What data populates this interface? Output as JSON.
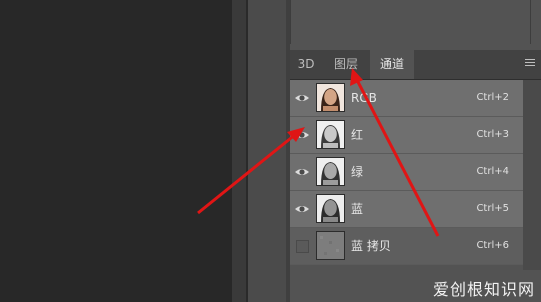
{
  "tabs": [
    {
      "label": "3D",
      "active": false
    },
    {
      "label": "图层",
      "active": false
    },
    {
      "label": "通道",
      "active": true
    }
  ],
  "panel_menu_icon": "panel-menu-icon",
  "channels": [
    {
      "name": "RGB",
      "shortcut": "Ctrl+2",
      "visible": true,
      "thumb": "color"
    },
    {
      "name": "红",
      "shortcut": "Ctrl+3",
      "visible": true,
      "thumb": "gray"
    },
    {
      "name": "绿",
      "shortcut": "Ctrl+4",
      "visible": true,
      "thumb": "gray"
    },
    {
      "name": "蓝",
      "shortcut": "Ctrl+5",
      "visible": true,
      "thumb": "gray"
    },
    {
      "name": "蓝 拷贝",
      "shortcut": "Ctrl+6",
      "visible": false,
      "thumb": "noise"
    }
  ],
  "annotation_arrows": {
    "color": "#e01515",
    "count": 2
  },
  "watermark": {
    "text": "爱创根知识网"
  },
  "colors": {
    "panel_bg": "#535353",
    "row_bg": "#6f6f6f",
    "tab_bar": "#424242",
    "canvas_bg": "#282828"
  }
}
